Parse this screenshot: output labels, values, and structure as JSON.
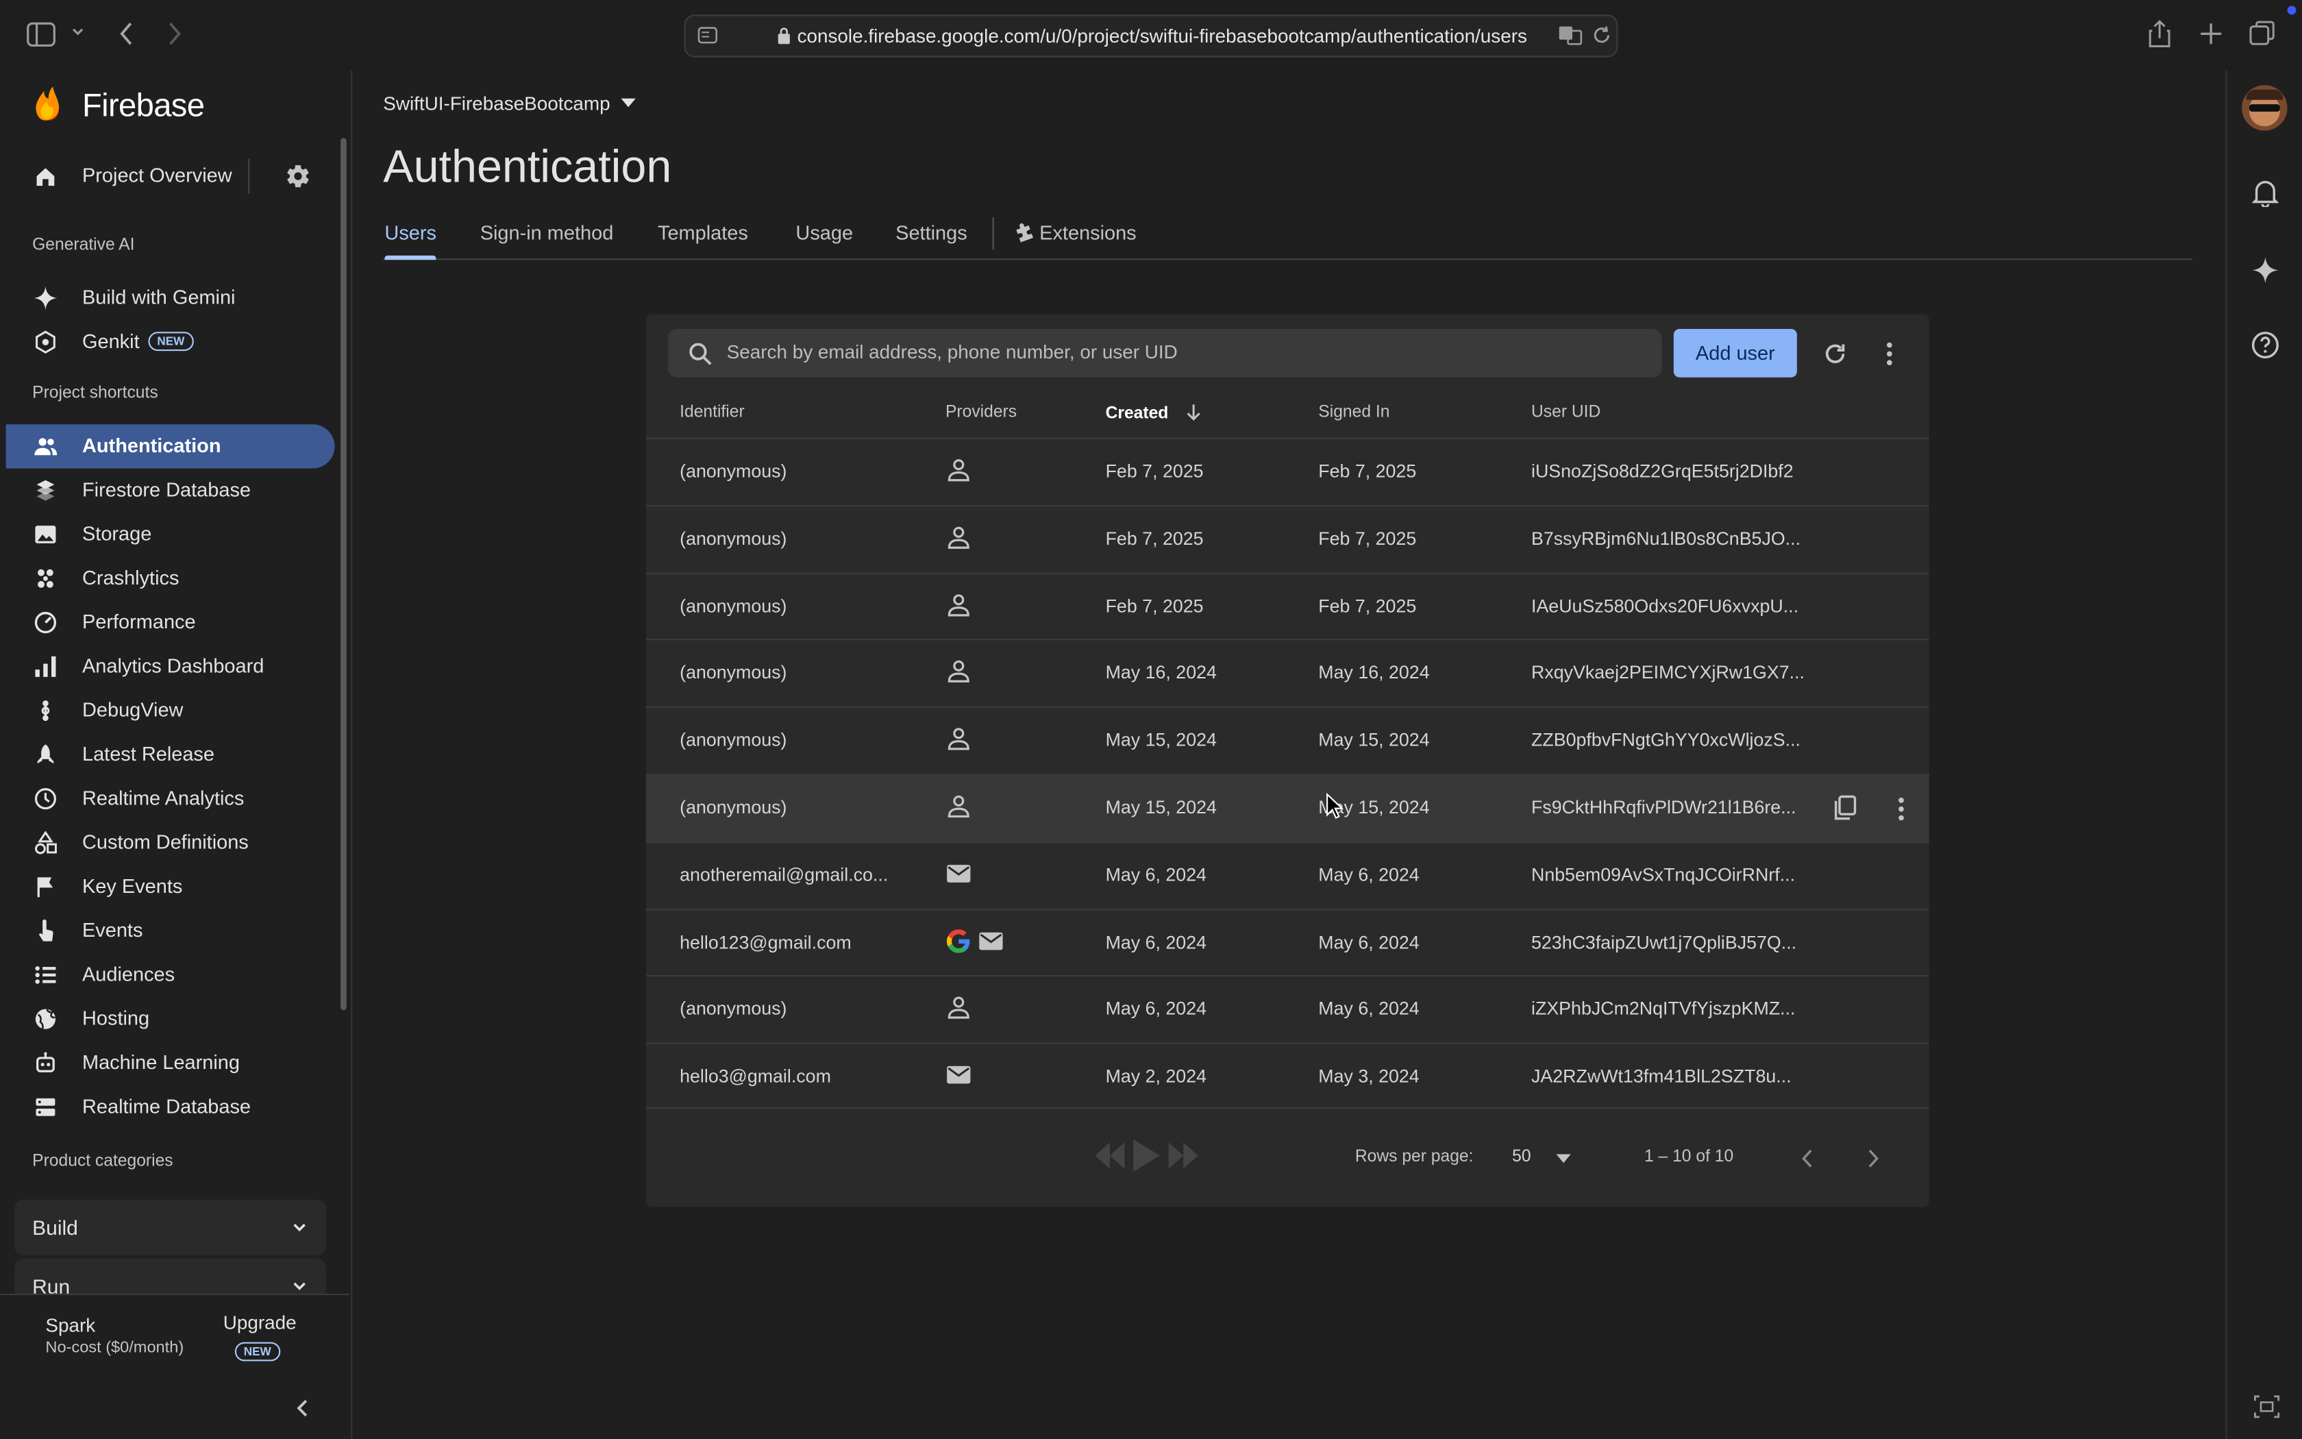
{
  "browser": {
    "url": "console.firebase.google.com/u/0/project/swiftui-firebasebootcamp/authentication/users"
  },
  "sidebar": {
    "brand": "Firebase",
    "project_overview": "Project Overview",
    "sections": {
      "generative_ai": "Generative AI",
      "project_shortcuts": "Project shortcuts",
      "product_categories": "Product categories"
    },
    "gen_ai_items": [
      {
        "label": "Build with Gemini",
        "icon": "sparkle-icon"
      },
      {
        "label": "Genkit",
        "icon": "genkit-icon",
        "badge": "NEW"
      }
    ],
    "shortcuts": [
      {
        "label": "Authentication",
        "icon": "people-icon",
        "active": true
      },
      {
        "label": "Firestore Database",
        "icon": "firestore-icon"
      },
      {
        "label": "Storage",
        "icon": "image-icon"
      },
      {
        "label": "Crashlytics",
        "icon": "crashlytics-icon"
      },
      {
        "label": "Performance",
        "icon": "speedometer-icon"
      },
      {
        "label": "Analytics Dashboard",
        "icon": "bar-chart-icon"
      },
      {
        "label": "DebugView",
        "icon": "debug-icon"
      },
      {
        "label": "Latest Release",
        "icon": "rocket-icon"
      },
      {
        "label": "Realtime Analytics",
        "icon": "clock-icon"
      },
      {
        "label": "Custom Definitions",
        "icon": "shapes-icon"
      },
      {
        "label": "Key Events",
        "icon": "flag-icon"
      },
      {
        "label": "Events",
        "icon": "touch-icon"
      },
      {
        "label": "Audiences",
        "icon": "list-icon"
      },
      {
        "label": "Hosting",
        "icon": "globe-icon"
      },
      {
        "label": "Machine Learning",
        "icon": "robot-icon"
      },
      {
        "label": "Realtime Database",
        "icon": "database-icon"
      }
    ],
    "categories": [
      "Build",
      "Run"
    ],
    "plan": {
      "name": "Spark",
      "desc": "No-cost ($0/month)",
      "upgrade": "Upgrade",
      "upgrade_badge": "NEW"
    }
  },
  "header": {
    "project": "SwiftUI-FirebaseBootcamp",
    "title": "Authentication",
    "tabs": [
      "Users",
      "Sign-in method",
      "Templates",
      "Usage",
      "Settings",
      "Extensions"
    ]
  },
  "users_table": {
    "search_placeholder": "Search by email address, phone number, or user UID",
    "add_user": "Add user",
    "columns": [
      "Identifier",
      "Providers",
      "Created",
      "Signed In",
      "User UID"
    ],
    "rows": [
      {
        "identifier": "(anonymous)",
        "providers": [
          "anonymous"
        ],
        "created": "Feb 7, 2025",
        "signed_in": "Feb 7, 2025",
        "uid": "iUSnoZjSo8dZ2GrqE5t5rj2DIbf2"
      },
      {
        "identifier": "(anonymous)",
        "providers": [
          "anonymous"
        ],
        "created": "Feb 7, 2025",
        "signed_in": "Feb 7, 2025",
        "uid": "B7ssyRBjm6Nu1lB0s8CnB5JO..."
      },
      {
        "identifier": "(anonymous)",
        "providers": [
          "anonymous"
        ],
        "created": "Feb 7, 2025",
        "signed_in": "Feb 7, 2025",
        "uid": "IAeUuSz580Odxs20FU6xvxpU..."
      },
      {
        "identifier": "(anonymous)",
        "providers": [
          "anonymous"
        ],
        "created": "May 16, 2024",
        "signed_in": "May 16, 2024",
        "uid": "RxqyVkaej2PEIMCYXjRw1GX7..."
      },
      {
        "identifier": "(anonymous)",
        "providers": [
          "anonymous"
        ],
        "created": "May 15, 2024",
        "signed_in": "May 15, 2024",
        "uid": "ZZB0pfbvFNgtGhYY0xcWljozS..."
      },
      {
        "identifier": "(anonymous)",
        "providers": [
          "anonymous"
        ],
        "created": "May 15, 2024",
        "signed_in": "May 15, 2024",
        "uid": "Fs9CktHhRqfivPlDWr21l1B6re..."
      },
      {
        "identifier": "anotheremail@gmail.co...",
        "providers": [
          "email"
        ],
        "created": "May 6, 2024",
        "signed_in": "May 6, 2024",
        "uid": "Nnb5em09AvSxTnqJCOirRNrf..."
      },
      {
        "identifier": "hello123@gmail.com",
        "providers": [
          "google",
          "email"
        ],
        "created": "May 6, 2024",
        "signed_in": "May 6, 2024",
        "uid": "523hC3faipZUwt1j7QpliBJ57Q..."
      },
      {
        "identifier": "(anonymous)",
        "providers": [
          "anonymous"
        ],
        "created": "May 6, 2024",
        "signed_in": "May 6, 2024",
        "uid": "iZXPhbJCm2NqITVfYjszpKMZ..."
      },
      {
        "identifier": "hello3@gmail.com",
        "providers": [
          "email"
        ],
        "created": "May 2, 2024",
        "signed_in": "May 3, 2024",
        "uid": "JA2RZwWt13fm41BlL2SZT8u..."
      }
    ],
    "footer": {
      "rows_per_page_label": "Rows per page:",
      "rows_per_page_value": "50",
      "range": "1 – 10 of 10"
    }
  },
  "colors": {
    "accent": "#a8c7fa",
    "active_nav": "#3d5a95",
    "add_user_button": "#8ab4f8"
  }
}
